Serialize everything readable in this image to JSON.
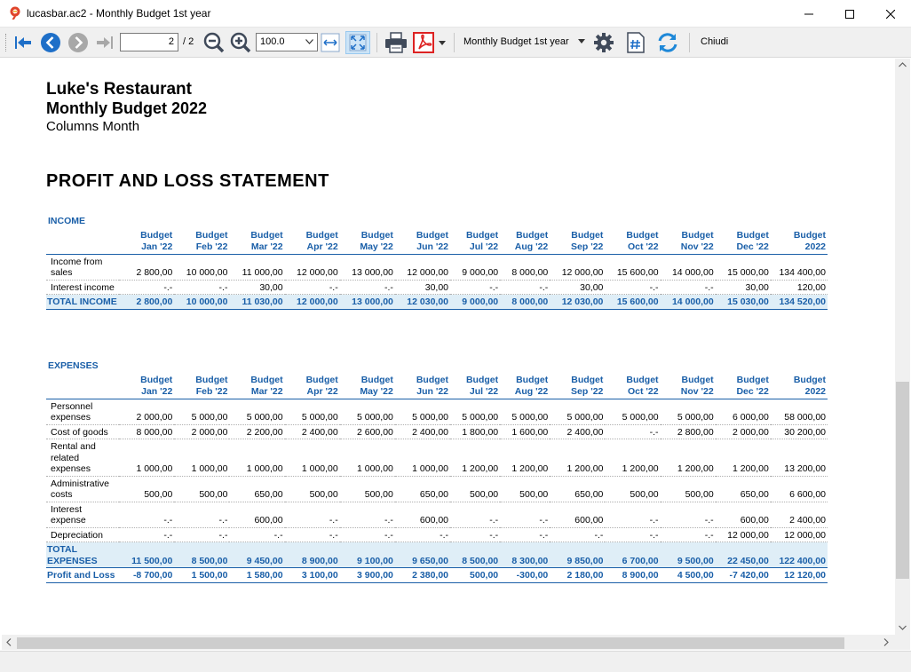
{
  "window": {
    "title": "lucasbar.ac2 - Monthly Budget 1st year"
  },
  "toolbar": {
    "page_value": "2",
    "page_total": "/ 2",
    "zoom_value": "100.0",
    "report_select": "Monthly Budget 1st year",
    "close_label": "Chiudi",
    "icons": [
      "arrow-left-icon",
      "back-circle-icon",
      "forward-circle-icon",
      "arrow-right-icon",
      "zoom-out-icon",
      "zoom-in-icon",
      "fit-width-icon",
      "fit-page-icon",
      "printer-icon",
      "pdf-icon",
      "gear-icon",
      "hash-document-icon",
      "refresh-icon"
    ],
    "accent": "#1e6fc8"
  },
  "report": {
    "company": "Luke's Restaurant",
    "title": "Monthly Budget 2022",
    "subtitle": "Columns Month",
    "section_title": "PROFIT AND LOSS STATEMENT",
    "accent_color": "#1a5fa8",
    "total_bg": "#dfeef7",
    "columns": [
      [
        "Budget",
        "Jan '22"
      ],
      [
        "Budget",
        "Feb '22"
      ],
      [
        "Budget",
        "Mar '22"
      ],
      [
        "Budget",
        "Apr '22"
      ],
      [
        "Budget",
        "May '22"
      ],
      [
        "Budget",
        "Jun '22"
      ],
      [
        "Budget",
        "Jul '22"
      ],
      [
        "Budget",
        "Aug '22"
      ],
      [
        "Budget",
        "Sep '22"
      ],
      [
        "Budget",
        "Oct '22"
      ],
      [
        "Budget",
        "Nov '22"
      ],
      [
        "Budget",
        "Dec '22"
      ],
      [
        "Budget",
        "2022"
      ]
    ],
    "income": {
      "label": "INCOME",
      "rows": [
        {
          "label": "Income from sales",
          "values": [
            "2 800,00",
            "10 000,00",
            "11 000,00",
            "12 000,00",
            "13 000,00",
            "12 000,00",
            "9 000,00",
            "8 000,00",
            "12 000,00",
            "15 600,00",
            "14 000,00",
            "15 000,00",
            "134 400,00"
          ]
        },
        {
          "label": "Interest income",
          "values": [
            "-.-",
            "-.-",
            "30,00",
            "-.-",
            "-.-",
            "30,00",
            "-.-",
            "-.-",
            "30,00",
            "-.-",
            "-.-",
            "30,00",
            "120,00"
          ]
        }
      ],
      "total": {
        "label": "TOTAL INCOME",
        "values": [
          "2 800,00",
          "10 000,00",
          "11 030,00",
          "12 000,00",
          "13 000,00",
          "12 030,00",
          "9 000,00",
          "8 000,00",
          "12 030,00",
          "15 600,00",
          "14 000,00",
          "15 030,00",
          "134 520,00"
        ]
      }
    },
    "expenses": {
      "label": "EXPENSES",
      "rows": [
        {
          "label": "Personnel expenses",
          "values": [
            "2 000,00",
            "5 000,00",
            "5 000,00",
            "5 000,00",
            "5 000,00",
            "5 000,00",
            "5 000,00",
            "5 000,00",
            "5 000,00",
            "5 000,00",
            "5 000,00",
            "6 000,00",
            "58 000,00"
          ]
        },
        {
          "label": "Cost of goods",
          "values": [
            "8 000,00",
            "2 000,00",
            "2 200,00",
            "2 400,00",
            "2 600,00",
            "2 400,00",
            "1 800,00",
            "1 600,00",
            "2 400,00",
            "-.-",
            "2 800,00",
            "2 000,00",
            "30 200,00"
          ]
        },
        {
          "label": "Rental and related expenses",
          "values": [
            "1 000,00",
            "1 000,00",
            "1 000,00",
            "1 000,00",
            "1 000,00",
            "1 000,00",
            "1 200,00",
            "1 200,00",
            "1 200,00",
            "1 200,00",
            "1 200,00",
            "1 200,00",
            "13 200,00"
          ]
        },
        {
          "label": "Administrative costs",
          "values": [
            "500,00",
            "500,00",
            "650,00",
            "500,00",
            "500,00",
            "650,00",
            "500,00",
            "500,00",
            "650,00",
            "500,00",
            "500,00",
            "650,00",
            "6 600,00"
          ]
        },
        {
          "label": "Interest expense",
          "values": [
            "-.-",
            "-.-",
            "600,00",
            "-.-",
            "-.-",
            "600,00",
            "-.-",
            "-.-",
            "600,00",
            "-.-",
            "-.-",
            "600,00",
            "2 400,00"
          ]
        },
        {
          "label": "Depreciation",
          "values": [
            "-.-",
            "-.-",
            "-.-",
            "-.-",
            "-.-",
            "-.-",
            "-.-",
            "-.-",
            "-.-",
            "-.-",
            "-.-",
            "12 000,00",
            "12 000,00"
          ]
        }
      ],
      "total": {
        "label": "TOTAL EXPENSES",
        "values": [
          "11 500,00",
          "8 500,00",
          "9 450,00",
          "8 900,00",
          "9 100,00",
          "9 650,00",
          "8 500,00",
          "8 300,00",
          "9 850,00",
          "6 700,00",
          "9 500,00",
          "22 450,00",
          "122 400,00"
        ]
      },
      "profit": {
        "label": "Profit and Loss",
        "values": [
          "-8 700,00",
          "1 500,00",
          "1 580,00",
          "3 100,00",
          "3 900,00",
          "2 380,00",
          "500,00",
          "-300,00",
          "2 180,00",
          "8 900,00",
          "4 500,00",
          "-7 420,00",
          "12 120,00"
        ]
      }
    }
  }
}
